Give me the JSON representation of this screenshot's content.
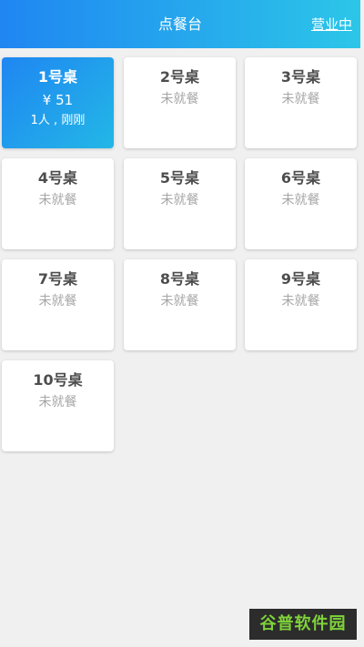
{
  "header": {
    "title": "点餐台",
    "status": "营业中"
  },
  "tables": [
    {
      "name": "1号桌",
      "active": true,
      "price": "¥ 51",
      "info": "1人 , 刚刚"
    },
    {
      "name": "2号桌",
      "state": "未就餐"
    },
    {
      "name": "3号桌",
      "state": "未就餐"
    },
    {
      "name": "4号桌",
      "state": "未就餐"
    },
    {
      "name": "5号桌",
      "state": "未就餐"
    },
    {
      "name": "6号桌",
      "state": "未就餐"
    },
    {
      "name": "7号桌",
      "state": "未就餐"
    },
    {
      "name": "8号桌",
      "state": "未就餐"
    },
    {
      "name": "9号桌",
      "state": "未就餐"
    },
    {
      "name": "10号桌",
      "state": "未就餐"
    }
  ],
  "watermark": "谷普软件园",
  "colors": {
    "header_gradient_start": "#1f86f2",
    "header_gradient_end": "#2cc6e8",
    "active_card": "#1f86f2",
    "background": "#f0f0f0"
  }
}
